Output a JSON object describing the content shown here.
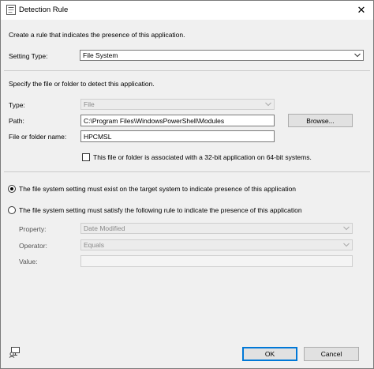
{
  "window": {
    "title": "Detection Rule",
    "close_glyph": "✕"
  },
  "intro": "Create a rule that indicates the presence of this application.",
  "setting_type": {
    "label": "Setting Type:",
    "value": "File System"
  },
  "file_section": {
    "heading": "Specify the file or folder to detect this application.",
    "type": {
      "label": "Type:",
      "value": "File"
    },
    "path": {
      "label": "Path:",
      "value": "C:\\Program Files\\WindowsPowerShell\\Modules"
    },
    "browse_label": "Browse...",
    "name": {
      "label": "File or folder name:",
      "value": "HPCMSL"
    },
    "checkbox_label": "This file or folder is associated with a 32-bit application on 64-bit systems."
  },
  "radios": {
    "exist": {
      "label": "The file system setting must exist on the target system to indicate presence of this application",
      "selected": true
    },
    "rule": {
      "label": "The file system setting must satisfy the following rule to indicate the presence of this application",
      "selected": false
    }
  },
  "rule": {
    "property": {
      "label": "Property:",
      "value": "Date Modified"
    },
    "operator": {
      "label": "Operator:",
      "value": "Equals"
    },
    "value": {
      "label": "Value:",
      "value": ""
    }
  },
  "buttons": {
    "ok": "OK",
    "cancel": "Cancel"
  },
  "icons": {
    "title": "application-window-icon",
    "status": "computer-user-icon"
  }
}
